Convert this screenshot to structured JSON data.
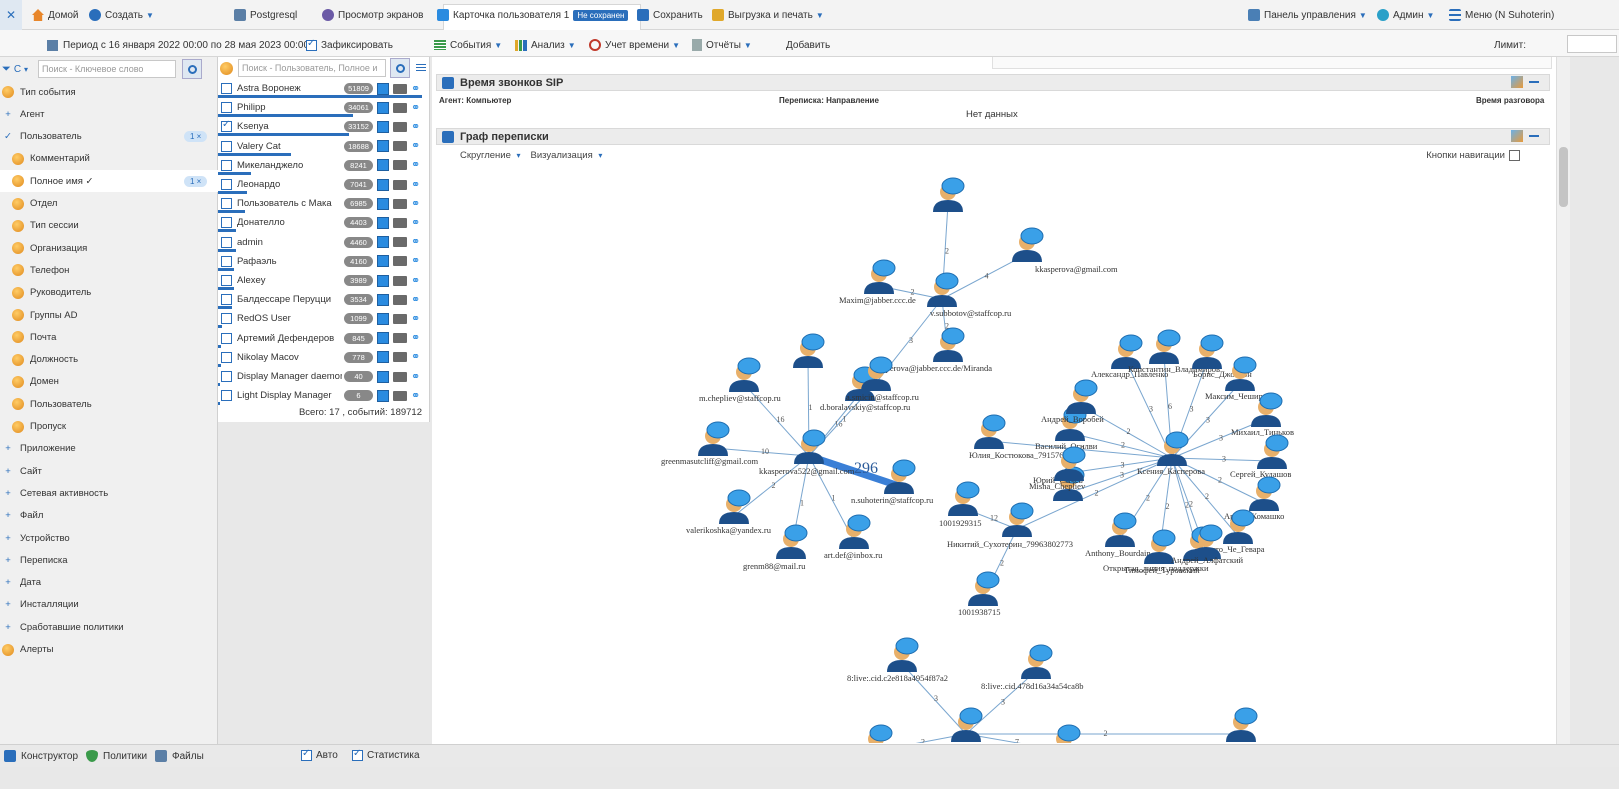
{
  "topbar": {
    "home": "Домой",
    "create": "Создать",
    "db": "Postgresql",
    "screens": "Просмотр экранов",
    "tab_title": "Карточка пользователя 1",
    "tab_badge": "Не сохранен",
    "save": "Сохранить",
    "export": "Выгрузка и печать",
    "dashboard": "Панель управления",
    "admin": "Админ",
    "menu": "Меню (N Suhoterin)"
  },
  "subbar": {
    "period": "Период с 16 января 2022 00:00 по 28 мая 2023 00:00",
    "fix": "Зафиксировать",
    "events": "События",
    "analysis": "Анализ",
    "time": "Учет времени",
    "reports": "Отчёты",
    "add": "Добавить",
    "limit": "Лимит:"
  },
  "left": {
    "filter": "С",
    "search_placeholder": "Поиск - Ключевое слово",
    "items": [
      {
        "label": "Тип события",
        "kind": "dot"
      },
      {
        "label": "Агент",
        "kind": "plus"
      },
      {
        "label": "Пользователь",
        "kind": "check",
        "pill": "1 ×"
      },
      {
        "label": "Комментарий",
        "kind": "dot"
      },
      {
        "label": "Полное имя ✓",
        "kind": "dot",
        "pill": "1 ×",
        "selected": true
      },
      {
        "label": "Отдел",
        "kind": "dot"
      },
      {
        "label": "Тип сессии",
        "kind": "dot"
      },
      {
        "label": "Организация",
        "kind": "dot"
      },
      {
        "label": "Телефон",
        "kind": "dot"
      },
      {
        "label": "Руководитель",
        "kind": "dot"
      },
      {
        "label": "Группы AD",
        "kind": "dot"
      },
      {
        "label": "Почта",
        "kind": "dot"
      },
      {
        "label": "Должность",
        "kind": "dot"
      },
      {
        "label": "Домен",
        "kind": "dot"
      },
      {
        "label": "Пользователь",
        "kind": "dot"
      },
      {
        "label": "Пропуск",
        "kind": "dot"
      },
      {
        "label": "Приложение",
        "kind": "plus"
      },
      {
        "label": "Сайт",
        "kind": "plus"
      },
      {
        "label": "Сетевая активность",
        "kind": "plus"
      },
      {
        "label": "Файл",
        "kind": "plus"
      },
      {
        "label": "Устройство",
        "kind": "plus"
      },
      {
        "label": "Переписка",
        "kind": "plus"
      },
      {
        "label": "Дата",
        "kind": "plus"
      },
      {
        "label": "Инсталляции",
        "kind": "plus"
      },
      {
        "label": "Сработавшие политики",
        "kind": "plus"
      },
      {
        "label": "Алерты",
        "kind": "dot"
      }
    ]
  },
  "users": {
    "search_placeholder": "Поиск - Пользователь, Полное и",
    "rows": [
      {
        "name": "Astra Воронеж",
        "count": "51809",
        "bar": 1.0,
        "checked": false
      },
      {
        "name": "Philipp",
        "count": "34061",
        "bar": 0.66,
        "checked": false
      },
      {
        "name": "Ksenya",
        "count": "33152",
        "bar": 0.64,
        "checked": true
      },
      {
        "name": "Valery Cat",
        "count": "18688",
        "bar": 0.36,
        "checked": false
      },
      {
        "name": "Микеланджело",
        "count": "8241",
        "bar": 0.16,
        "checked": false
      },
      {
        "name": "Леонардо",
        "count": "7041",
        "bar": 0.14,
        "checked": false
      },
      {
        "name": "Пользователь с Мака",
        "count": "6985",
        "bar": 0.13,
        "checked": false
      },
      {
        "name": "Донателло",
        "count": "4403",
        "bar": 0.09,
        "checked": false
      },
      {
        "name": "admin",
        "count": "4460",
        "bar": 0.09,
        "checked": false
      },
      {
        "name": "Рафаэль",
        "count": "4160",
        "bar": 0.08,
        "checked": false
      },
      {
        "name": "Alexey",
        "count": "3989",
        "bar": 0.08,
        "checked": false
      },
      {
        "name": "Балдессаре Перуцци",
        "count": "3534",
        "bar": 0.07,
        "checked": false
      },
      {
        "name": "RedOS User",
        "count": "1099",
        "bar": 0.02,
        "checked": false
      },
      {
        "name": "Артемий Дефендеров",
        "count": "845",
        "bar": 0.016,
        "checked": false
      },
      {
        "name": "Nikolay Macov",
        "count": "778",
        "bar": 0.015,
        "checked": false
      },
      {
        "name": "Display Manager daemon",
        "count": "40",
        "bar": 0.004,
        "checked": false
      },
      {
        "name": "Light Display Manager",
        "count": "6",
        "bar": 0.002,
        "checked": false
      }
    ],
    "total": "Всего: 17 , событий: 189712"
  },
  "sip": {
    "title": "Время звонков SIP",
    "col_agent": "Агент: Компьютер",
    "col_dir": "Переписка: Направление",
    "col_time": "Время разговора",
    "empty": "Нет данных"
  },
  "graph_section": {
    "title": "Граф переписки",
    "rounding": "Скругление",
    "visual": "Визуализация",
    "nav_buttons": "Кнопки навигации"
  },
  "graph": {
    "nodes": [
      {
        "id": "t1",
        "label": ""
      },
      {
        "id": "t2",
        "label": "kkasperova@gmail.com"
      },
      {
        "id": "maxim",
        "label": "Maxim@jabber.ccc.de"
      },
      {
        "id": "vsub",
        "label": "v.subbotov@staffcop.ru"
      },
      {
        "id": "miranda",
        "label": "kkasperova@jabber.ccc.de/Miranda"
      },
      {
        "id": "nodel",
        "label": ""
      },
      {
        "id": "dbor",
        "label": "d.boralavskiy@staffcop.ru"
      },
      {
        "id": "mchep",
        "label": "m.chepliev@staffcop.ru"
      },
      {
        "id": "asmic",
        "label": "a.smicin@staffcop.ru"
      },
      {
        "id": "green",
        "label": "greenmasutcliff@gmail.com"
      },
      {
        "id": "kkas22",
        "label": "kkasperova522@gmail.com"
      },
      {
        "id": "nsuho",
        "label": "n.suhoterin@staffcop.ru"
      },
      {
        "id": "valeri",
        "label": "valerikoshka@yandex.ru"
      },
      {
        "id": "grenm",
        "label": "grenm88@mail.ru"
      },
      {
        "id": "artdef",
        "label": "art.def@inbox.ru"
      },
      {
        "id": "yulia",
        "label": "Юлия_Костюкова_79157692548"
      },
      {
        "id": "n1001",
        "label": "1001929315"
      },
      {
        "id": "niksuh",
        "label": "Никитий_Сухотерин_79963802773"
      },
      {
        "id": "n1001b",
        "label": "1001938715"
      },
      {
        "id": "yuriy",
        "label": "Юрий_Сычев"
      },
      {
        "id": "ksenkasp",
        "label": "Ксения_Касперова"
      },
      {
        "id": "vasiliy",
        "label": "Василий_Огилви"
      },
      {
        "id": "mchep2",
        "label": "Misha_Chepliev"
      },
      {
        "id": "avor",
        "label": "Андрей_Воробей"
      },
      {
        "id": "apav",
        "label": "Александр_Павленко"
      },
      {
        "id": "kvlad",
        "label": "Константин_Владимиров"
      },
      {
        "id": "boris",
        "label": "Борис_Джонсон"
      },
      {
        "id": "maxch",
        "label": "Максим_Чеширов"
      },
      {
        "id": "mikh",
        "label": "Михаил_Тиньков"
      },
      {
        "id": "sergk",
        "label": "Сергей_Кудашов"
      },
      {
        "id": "kom",
        "label": "Артем_Комашко"
      },
      {
        "id": "erne",
        "label": "Эрнесто_Че_Гевара"
      },
      {
        "id": "antb",
        "label": "Anthony_Bourdain"
      },
      {
        "id": "tim",
        "label": "Тимофей_Туровский"
      },
      {
        "id": "otkr",
        "label": "Открытая_линия_поддержки"
      },
      {
        "id": "andr",
        "label": "Андрей_Алфатский"
      },
      {
        "id": "live1",
        "label": "8:live:.cid.c2e818a4954f87a2"
      },
      {
        "id": "live2",
        "label": "8:live:.cid.478d16a34a54ca8b"
      },
      {
        "id": "b1",
        "label": ""
      },
      {
        "id": "b2",
        "label": ""
      },
      {
        "id": "b3",
        "label": ""
      },
      {
        "id": "b4",
        "label": ""
      }
    ],
    "edges": [
      {
        "from": "t1",
        "to": "vsub",
        "label": "2"
      },
      {
        "from": "t2",
        "to": "vsub",
        "label": "4"
      },
      {
        "from": "maxim",
        "to": "vsub",
        "label": "2"
      },
      {
        "from": "vsub",
        "to": "miranda",
        "label": "2"
      },
      {
        "from": "vsub",
        "to": "asmic",
        "label": "3"
      },
      {
        "from": "dbor",
        "to": "kkas22",
        "label": "16"
      },
      {
        "from": "mchep",
        "to": "kkas22",
        "label": "16"
      },
      {
        "from": "asmic",
        "to": "kkas22",
        "label": "1"
      },
      {
        "from": "green",
        "to": "kkas22",
        "label": "10"
      },
      {
        "from": "kkas22",
        "to": "nsuho",
        "label": "296"
      },
      {
        "from": "kkas22",
        "to": "valeri",
        "label": "2"
      },
      {
        "from": "kkas22",
        "to": "grenm",
        "label": "1"
      },
      {
        "from": "kkas22",
        "to": "artdef",
        "label": "1"
      },
      {
        "from": "nodel",
        "to": "kkas22",
        "label": "1"
      },
      {
        "from": "yulia",
        "to": "ksenkasp",
        "label": "2"
      },
      {
        "from": "n1001",
        "to": "niksuh",
        "label": "12"
      },
      {
        "from": "niksuh",
        "to": "n1001b",
        "label": "2"
      },
      {
        "from": "niksuh",
        "to": "ksenkasp",
        "label": "2"
      },
      {
        "from": "yuriy",
        "to": "ksenkasp",
        "label": "3"
      },
      {
        "from": "vasiliy",
        "to": "ksenkasp",
        "label": "2"
      },
      {
        "from": "mchep2",
        "to": "ksenkasp",
        "label": "3"
      },
      {
        "from": "avor",
        "to": "ksenkasp",
        "label": "2"
      },
      {
        "from": "apav",
        "to": "ksenkasp",
        "label": "3"
      },
      {
        "from": "kvlad",
        "to": "ksenkasp",
        "label": "6"
      },
      {
        "from": "boris",
        "to": "ksenkasp",
        "label": "3"
      },
      {
        "from": "maxch",
        "to": "ksenkasp",
        "label": "3"
      },
      {
        "from": "mikh",
        "to": "ksenkasp",
        "label": "3"
      },
      {
        "from": "sergk",
        "to": "ksenkasp",
        "label": "3"
      },
      {
        "from": "kom",
        "to": "ksenkasp",
        "label": "2"
      },
      {
        "from": "erne",
        "to": "ksenkasp",
        "label": "2"
      },
      {
        "from": "antb",
        "to": "ksenkasp",
        "label": "2"
      },
      {
        "from": "tim",
        "to": "ksenkasp",
        "label": "2"
      },
      {
        "from": "otkr",
        "to": "ksenkasp",
        "label": "2"
      },
      {
        "from": "andr",
        "to": "ksenkasp",
        "label": "2"
      },
      {
        "from": "live1",
        "to": "b3",
        "label": "3"
      },
      {
        "from": "live2",
        "to": "b3",
        "label": "3"
      },
      {
        "from": "b1",
        "to": "b3",
        "label": "2"
      },
      {
        "from": "b3",
        "to": "b4",
        "label": "7"
      },
      {
        "from": "b3",
        "to": "b2",
        "label": "2"
      }
    ]
  },
  "footer": {
    "constructor": "Конструктор",
    "policies": "Политики",
    "files": "Файлы",
    "auto": "Авто",
    "stats": "Статистика"
  }
}
